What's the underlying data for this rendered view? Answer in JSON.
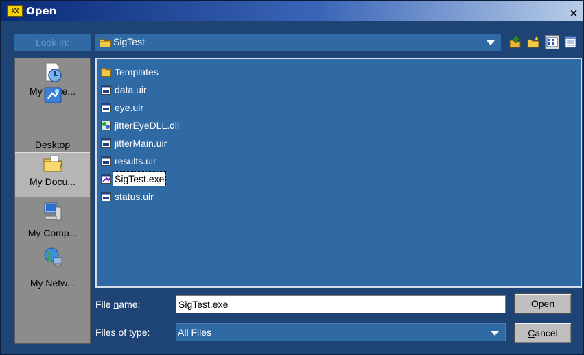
{
  "window": {
    "title": "Open",
    "app_icon_text": "XX",
    "close_label": "×"
  },
  "look_in": {
    "label": "Look in:",
    "value": "SigTest"
  },
  "toolbar": [
    "up-one-level",
    "create-new-folder",
    "list-view",
    "details-view"
  ],
  "places": [
    {
      "label": "My Rece...",
      "icon": "recent-documents-icon"
    },
    {
      "label": "Desktop",
      "icon": "desktop-icon"
    },
    {
      "label": "My Docu...",
      "icon": "my-documents-icon",
      "selected": true
    },
    {
      "label": "My Comp...",
      "icon": "my-computer-icon"
    },
    {
      "label": "My Netw...",
      "icon": "my-network-icon"
    }
  ],
  "files": [
    {
      "name": "Templates",
      "icon": "folder-icon"
    },
    {
      "name": "data.uir",
      "icon": "uir-file-icon"
    },
    {
      "name": "eye.uir",
      "icon": "uir-file-icon"
    },
    {
      "name": "jitterEyeDLL.dll",
      "icon": "dll-file-icon"
    },
    {
      "name": "jitterMain.uir",
      "icon": "uir-file-icon"
    },
    {
      "name": "results.uir",
      "icon": "uir-file-icon"
    },
    {
      "name": "SigTest.exe",
      "icon": "exe-file-icon",
      "selected": true
    },
    {
      "name": "status.uir",
      "icon": "uir-file-icon"
    }
  ],
  "file_name": {
    "label_pre": "File ",
    "label_accel": "n",
    "label_post": "ame:",
    "value": "SigTest.exe"
  },
  "file_type": {
    "label": "Files of type:",
    "value": "All Files"
  },
  "buttons": {
    "open_accel": "O",
    "open_rest": "pen",
    "cancel_accel": "C",
    "cancel_rest": "ancel"
  }
}
